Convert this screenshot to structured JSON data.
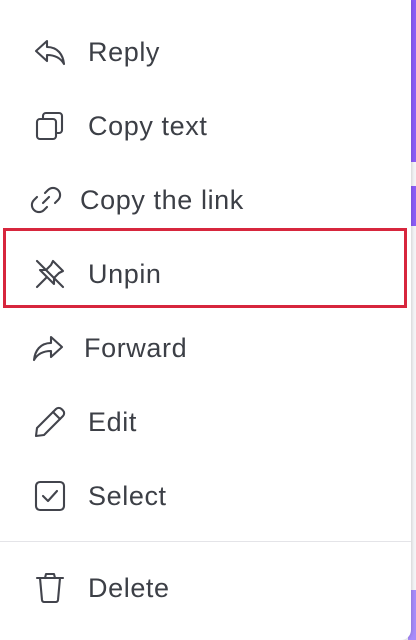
{
  "menu": {
    "items": [
      {
        "label": "Reply",
        "icon": "reply-icon"
      },
      {
        "label": "Copy text",
        "icon": "copy-icon"
      },
      {
        "label": "Copy the link",
        "icon": "link-icon"
      },
      {
        "label": "Unpin",
        "icon": "unpin-icon"
      },
      {
        "label": "Forward",
        "icon": "forward-icon"
      },
      {
        "label": "Edit",
        "icon": "pencil-icon"
      },
      {
        "label": "Select",
        "icon": "checkbox-icon"
      },
      {
        "label": "Delete",
        "icon": "trash-icon"
      }
    ],
    "highlighted_item": "Unpin"
  },
  "colors": {
    "text": "#3c3f46",
    "icon": "#42444c",
    "highlight_border": "#d7263d",
    "accent": "#8b5cf6"
  }
}
